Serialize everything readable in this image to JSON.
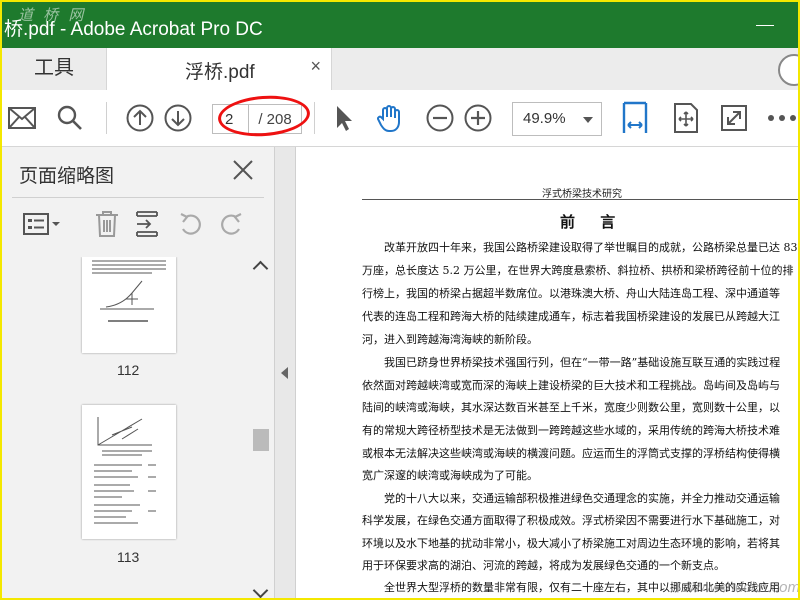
{
  "window": {
    "title": "桥.pdf - Adobe Acrobat Pro DC",
    "watermark_top": "道 桥 网"
  },
  "tabs": {
    "tools": "工具",
    "document": "浮桥.pdf",
    "close": "×"
  },
  "toolbar": {
    "page_current": "2",
    "page_total": "/ 208",
    "zoom": "49.9%"
  },
  "left_panel": {
    "title": "页面缩略图",
    "thumbnails": [
      {
        "label": "112"
      },
      {
        "label": "113"
      }
    ]
  },
  "document": {
    "running_head": "浮式桥梁技术研究",
    "heading": "前 言",
    "lines": [
      "改革开放四十年来，我国公路桥梁建设取得了举世瞩目的成就，公路桥梁总量已达 83",
      "万座，总长度达 5.2 万公里，在世界大跨度悬索桥、斜拉桥、拱桥和梁桥跨径前十位的排",
      "行榜上，我国的桥梁占据超半数席位。以港珠澳大桥、舟山大陆连岛工程、深中通道等",
      "代表的连岛工程和跨海大桥的陆续建成通车，标志着我国桥梁建设的发展已从跨越大江",
      "河，进入到跨越海湾海峡的新阶段。",
      "我国已跻身世界桥梁技术强国行列，但在“一带一路”基础设施互联互通的实践过程",
      "依然面对跨越峡湾或宽而深的海峡上建设桥梁的巨大技术和工程挑战。岛屿间及岛屿与",
      "陆间的峡湾或海峡，其水深达数百米甚至上千米，宽度少则数公里，宽则数十公里，以",
      "有的常规大跨径桥型技术是无法做到一跨跨越这些水域的，采用传统的跨海大桥技术难",
      "或根本无法解决这些峡湾或海峡的横渡问题。应运而生的浮筒式支撑的浮桥结构使得横",
      "宽广深邃的峡湾或海峡成为了可能。",
      "党的十八大以来，交通运输部积极推进绿色交通理念的实施，并全力推动交通运输",
      "科学发展，在绿色交通方面取得了积极成效。浮式桥梁因不需要进行水下基础施工，对",
      "环境以及水下地基的扰动非常小，极大减小了桥梁施工对周边生态环境的影响，若将其",
      "用于环保要求高的湖泊、河流的跨越，将成为发展绿色交通的一个新支点。",
      "全世界大型浮桥的数量非常有限，仅有二十座左右，其中以挪威和北美的实践应用"
    ],
    "watermark": "www.cnddcn.com"
  }
}
